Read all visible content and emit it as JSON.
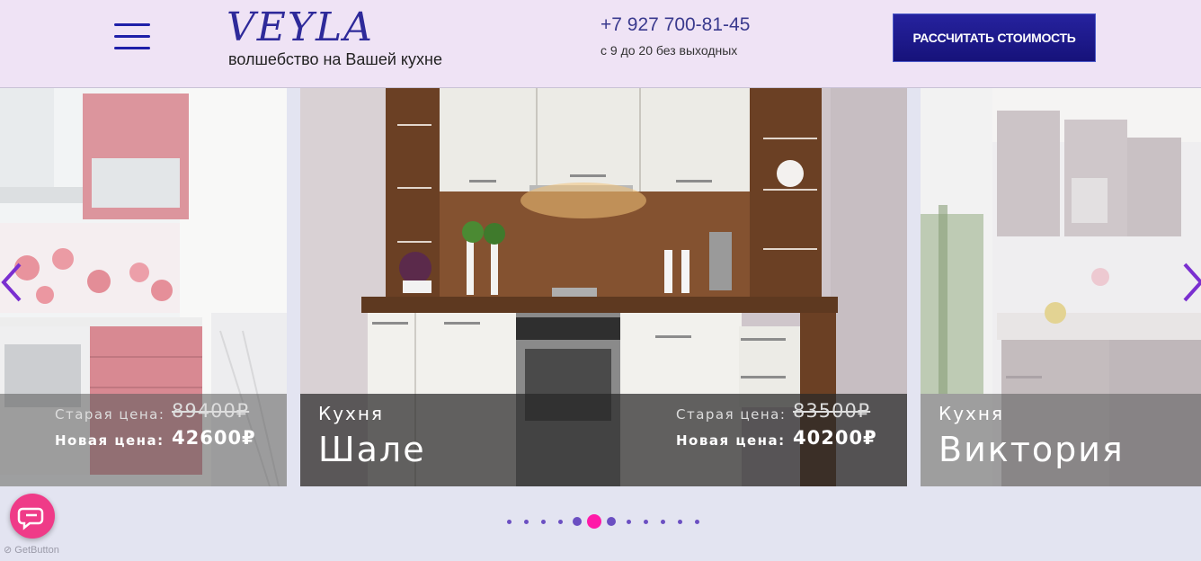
{
  "header": {
    "logo": "VEYLA",
    "tagline": "волшебство на Вашей кухне",
    "phone": "+7 927 700-81-45",
    "hours": "с 9 до 20 без выходных",
    "cta_label": "РАССЧИТАТЬ СТОИМОСТЬ"
  },
  "slides": [
    {
      "old_label": "Старая цена:",
      "old_price": "89400₽",
      "new_label": "Новая цена:",
      "new_price": "42600₽"
    },
    {
      "kitchen_word": "Кухня",
      "name": "Шале",
      "old_label": "Старая цена:",
      "old_price": "83500₽",
      "new_label": "Новая цена:",
      "new_price": "40200₽"
    },
    {
      "kitchen_word": "Кухня",
      "name": "Виктория"
    }
  ],
  "pagination": {
    "count": 12,
    "active_index": 5
  },
  "widget": {
    "brand": "GetButton"
  },
  "colors": {
    "accent": "#1e1fa8",
    "header_bg": "#efe3f5",
    "active_dot": "#ff1aa8",
    "chat_button": "#ef3b88"
  }
}
